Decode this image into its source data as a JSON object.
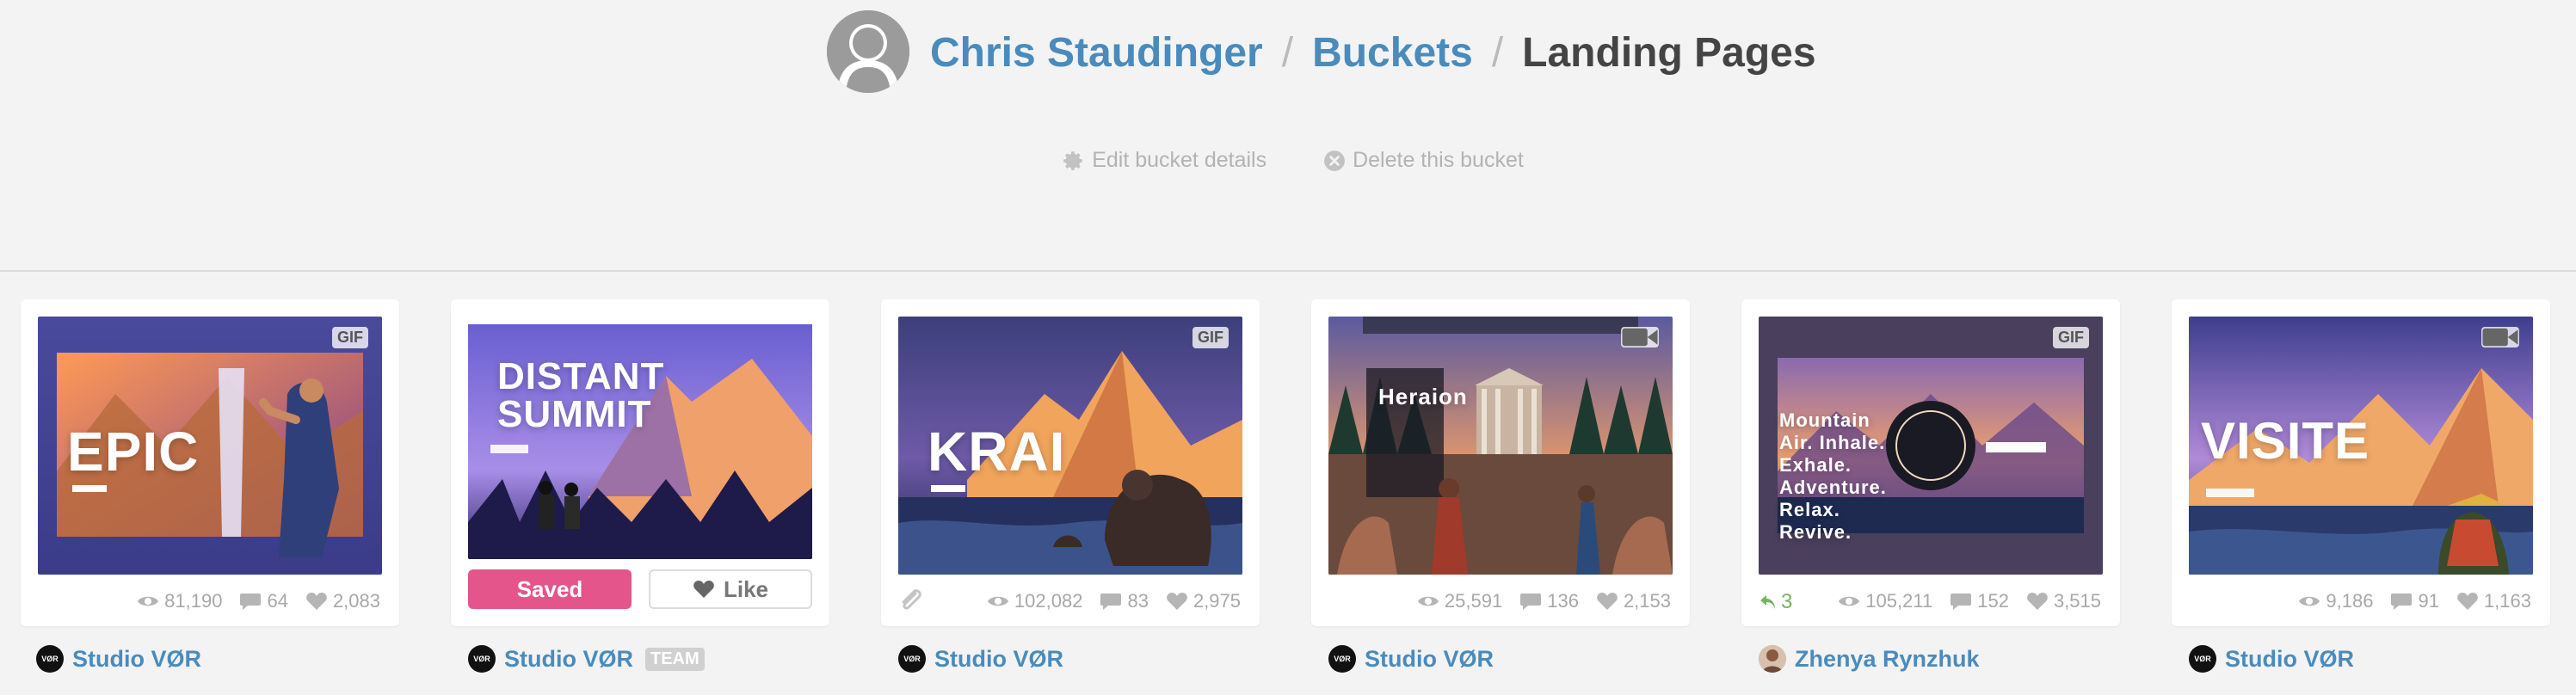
{
  "breadcrumb": {
    "user": "Chris Staudinger",
    "section": "Buckets",
    "current": "Landing Pages",
    "separator": "/"
  },
  "actions": {
    "edit": "Edit bucket details",
    "delete": "Delete this bucket"
  },
  "colors": {
    "link": "#4a8bbd",
    "saved_button": "#e4558c",
    "rebound": "#74b35a",
    "stat": "#a8a8a8"
  },
  "shots": [
    {
      "title": "EPIC",
      "badge": "GIF",
      "views": "81,190",
      "comments": "64",
      "likes": "2,083",
      "owner": "Studio VØR",
      "owner_logo": "VØR"
    },
    {
      "title": "DISTANT SUMMIT",
      "badge": "",
      "saved_label": "Saved",
      "like_label": "Like",
      "owner": "Studio VØR",
      "owner_logo": "VØR",
      "owner_tag": "TEAM"
    },
    {
      "title": "KRAI",
      "badge": "GIF",
      "views": "102,082",
      "comments": "83",
      "likes": "2,975",
      "owner": "Studio VØR",
      "owner_logo": "VØR"
    },
    {
      "title": "Heraion",
      "badge": "video",
      "views": "25,591",
      "comments": "136",
      "likes": "2,153",
      "owner": "Studio VØR",
      "owner_logo": "VØR"
    },
    {
      "title": "Mountain Air. Inhale. Exhale. Adventure. Relax. Revive.",
      "badge": "GIF",
      "rebounds": "3",
      "views": "105,211",
      "comments": "152",
      "likes": "3,515",
      "owner": "Zhenya Rynzhuk"
    },
    {
      "title": "VISITE",
      "badge": "video",
      "views": "9,186",
      "comments": "91",
      "likes": "1,163",
      "owner": "Studio VØR",
      "owner_logo": "VØR"
    }
  ]
}
